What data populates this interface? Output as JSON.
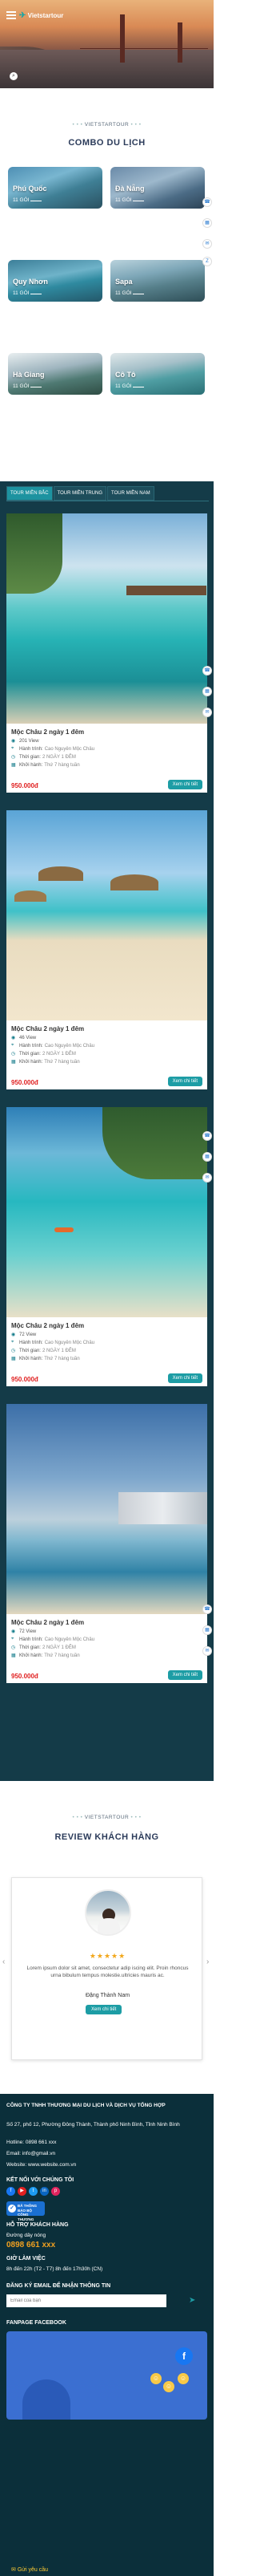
{
  "header": {
    "logo_text": "Vietstartour"
  },
  "combo": {
    "eyebrow": "VIETSTARTOUR",
    "title": "COMBO DU LỊCH",
    "items": [
      {
        "name": "Phú Quốc",
        "count": "11 GÓI"
      },
      {
        "name": "Đà Nẵng",
        "count": "11 GÓI"
      },
      {
        "name": "Quy Nhơn",
        "count": "11 GÓI"
      },
      {
        "name": "Sapa",
        "count": "11 GÓI"
      },
      {
        "name": "Hà Giang",
        "count": "11 GÓI"
      },
      {
        "name": "Cô Tô",
        "count": "11 GÓI"
      }
    ]
  },
  "tours": {
    "tabs": [
      "TOUR MIỀN BẮC",
      "TOUR MIỀN TRUNG",
      "TOUR MIỀN NAM"
    ],
    "itinerary_label": "Hành trình:",
    "duration_label": "Thời gian:",
    "departure_label": "Khởi hành:",
    "detail_label": "Xem chi tiết",
    "cards": [
      {
        "title": "Mộc Châu 2 ngày 1 đêm",
        "views": "201 View",
        "itinerary": "Cao Nguyên Mộc Châu",
        "duration": "2 NGÀY 1 ĐÊM",
        "departure": "Thứ 7 hàng tuần",
        "price": "950.000đ"
      },
      {
        "title": "Mộc Châu 2 ngày 1 đêm",
        "views": "46 View",
        "itinerary": "Cao Nguyên Mộc Châu",
        "duration": "2 NGÀY 1 ĐÊM",
        "departure": "Thứ 7 hàng tuần",
        "price": "950.000đ"
      },
      {
        "title": "Mộc Châu 2 ngày 1 đêm",
        "views": "72 View",
        "itinerary": "Cao Nguyên Mộc Châu",
        "duration": "2 NGÀY 1 ĐÊM",
        "departure": "Thứ 7 hàng tuần",
        "price": "950.000đ"
      },
      {
        "title": "Mộc Châu 2 ngày 1 đêm",
        "views": "72 View",
        "itinerary": "Cao Nguyên Mộc Châu",
        "duration": "2 NGÀY 1 ĐÊM",
        "departure": "Thứ 7 hàng tuần",
        "price": "950.000đ"
      }
    ]
  },
  "reviews": {
    "eyebrow": "VIETSTARTOUR",
    "title": "REVIEW KHÁCH HÀNG",
    "quote": "Lorem ipsum dolor sit amet, consectetur adip iscing elit. Proin rhoncus urna bibulum tempus molestie.ultricies mauris ac.",
    "author": "Đặng Thành Nam",
    "button": "Xem chi tiết"
  },
  "footer": {
    "company": "CÔNG TY TNHH THƯƠNG MẠI DU LỊCH VÀ DỊCH VỤ TỔNG HỢP",
    "address": "Số 27, phố 12, Phường Đông Thành, Thành phố Ninh Bình, Tỉnh Ninh Bình",
    "hotline": "Hotline: 0898 661 xxx",
    "email": "Email: info@gmail.vn",
    "website": "Website: www.website.com.vn",
    "connect_heading": "KẾT NỐI VỚI CHÚNG TÔI",
    "badge_text": "ĐÃ THÔNG BÁO BỘ CÔNG THƯƠNG",
    "support_heading": "HỖ TRỢ KHÁCH HÀNG",
    "support_line": "Đường dây nóng",
    "support_number": "0898 661 xxx",
    "hours_heading": "GIỜ LÀM VIỆC",
    "hours": "8h đến 22h (T2 - T7) 8h đến 17h30h (CN)",
    "subscribe_heading": "ĐĂNG KÝ EMAIL ĐỂ NHẬN THÔNG TIN",
    "subscribe_placeholder": "Email của bạn",
    "fanpage_heading": "FANPAGE FACEBOOK",
    "bottom_text": "Gửi yêu cầu"
  }
}
